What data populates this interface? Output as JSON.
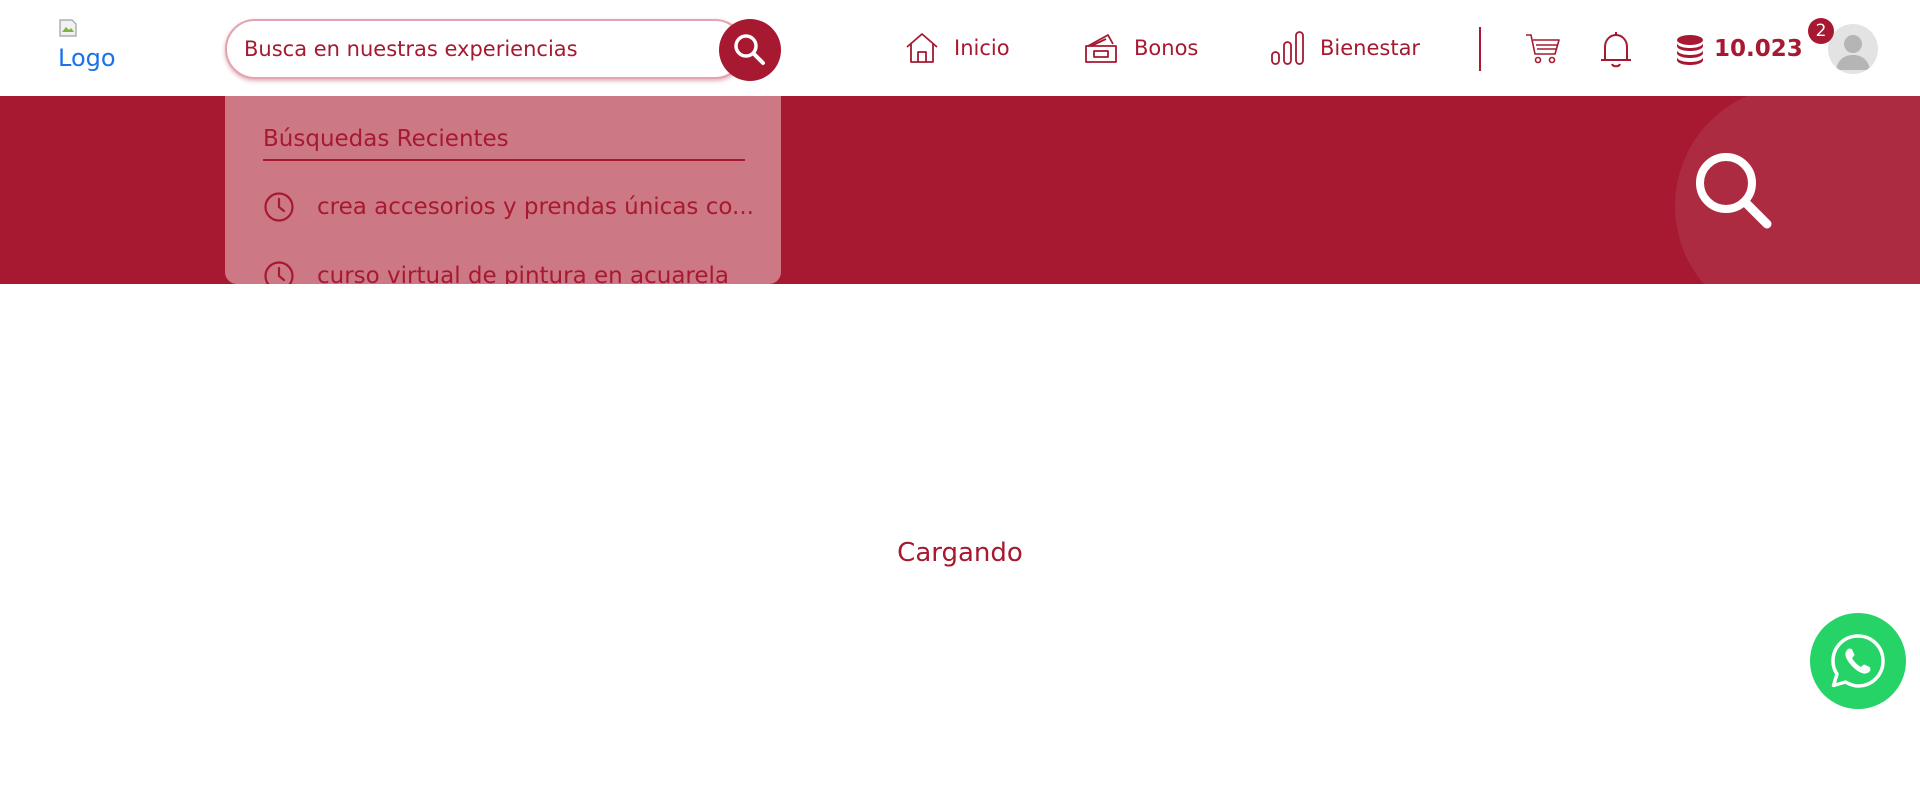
{
  "header": {
    "logo_alt": "Logo",
    "search": {
      "placeholder": "Busca en nuestras experiencias"
    },
    "nav": [
      {
        "label": "Inicio",
        "icon": "home-icon"
      },
      {
        "label": "Bonos",
        "icon": "ticket-icon"
      },
      {
        "label": "Bienestar",
        "icon": "bar-chart-icon"
      }
    ],
    "points": "10.023",
    "notification_count": "2"
  },
  "recent_searches": {
    "title": "Búsquedas Recientes",
    "items": [
      "crea accesorios y prendas únicas co...",
      "curso virtual de pintura en acuarela"
    ]
  },
  "main": {
    "loading_text": "Cargando"
  },
  "colors": {
    "primary": "#a61931",
    "dropdown_bg": "#cd7985",
    "whatsapp": "#25d366"
  }
}
